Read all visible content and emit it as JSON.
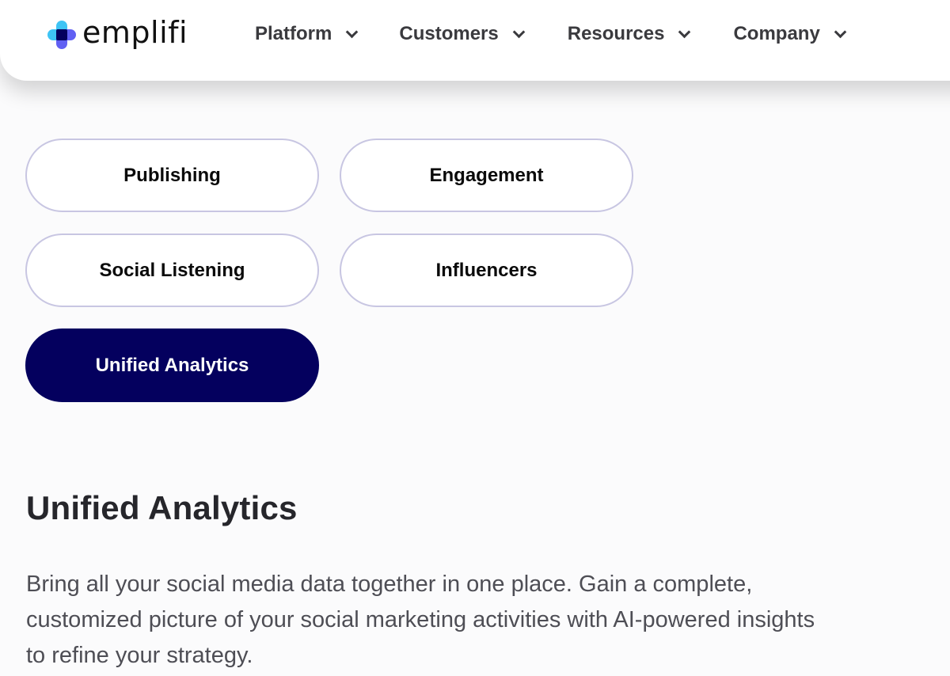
{
  "header": {
    "logo_text": "emplifi",
    "logo_colors": {
      "light_blue": "#3ec4f5",
      "purple": "#6160f3",
      "navy": "#04005e"
    },
    "nav": [
      {
        "label": "Platform",
        "icon": "chevron-down-icon"
      },
      {
        "label": "Customers",
        "icon": "chevron-down-icon"
      },
      {
        "label": "Resources",
        "icon": "chevron-down-icon"
      },
      {
        "label": "Company",
        "icon": "chevron-down-icon"
      }
    ]
  },
  "tabs": [
    {
      "label": "Publishing",
      "active": false
    },
    {
      "label": "Engagement",
      "active": false
    },
    {
      "label": "Social Listening",
      "active": false
    },
    {
      "label": "Influencers",
      "active": false
    },
    {
      "label": "Unified Analytics",
      "active": true
    }
  ],
  "colors": {
    "active_tab_bg": "#04005e",
    "tab_border": "#c8c6e2"
  },
  "section": {
    "title": "Unified Analytics",
    "description": "Bring all your social media data together in one place. Gain a complete, customized picture of your social marketing activities with AI-powered insights to refine your strategy."
  }
}
